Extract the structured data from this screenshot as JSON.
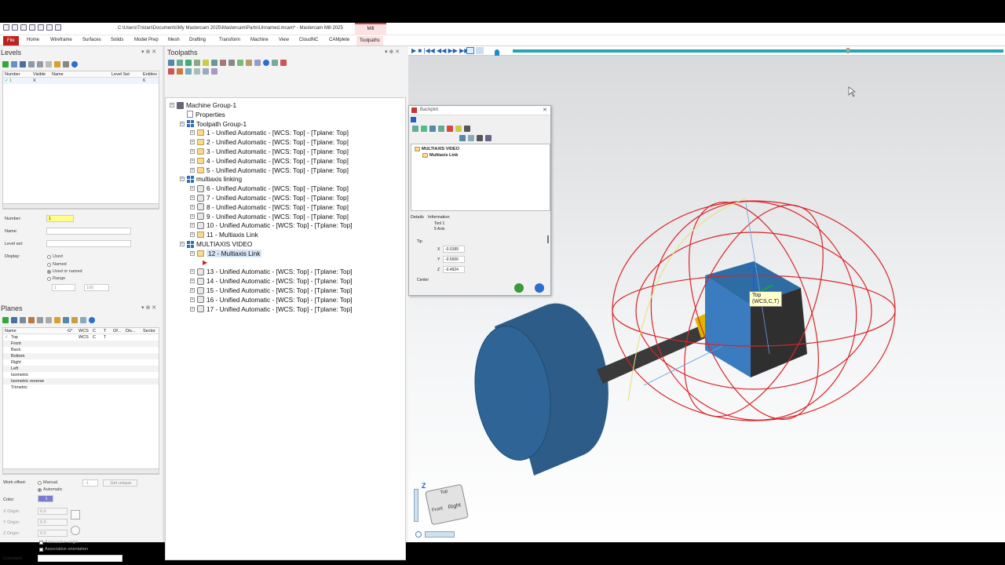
{
  "title_bar": {
    "window_title": "C:\\Users\\Tristan\\Documents\\My Mastercam 2025\\Mastercam\\Parts\\Unnamed.mcam* - Mastercam Mill 2025",
    "context_tab": "Mill"
  },
  "ribbon": {
    "tabs": [
      "File",
      "Home",
      "Wireframe",
      "Surfaces",
      "Solids",
      "Model Prep",
      "Mesh",
      "Drafting",
      "Transform",
      "Machine",
      "View",
      "CloudNC",
      "CAMplete",
      "Toolpaths"
    ]
  },
  "levels": {
    "title": "Levels",
    "columns": [
      "Number",
      "Visible",
      "Name",
      "Level Set",
      "Entities"
    ],
    "rows": [
      {
        "check": "✓",
        "number": "1",
        "visible": "X",
        "name": "",
        "level_set": "",
        "entities": "6"
      }
    ],
    "number_label": "Number:",
    "number_value": "1",
    "name_label": "Name:",
    "level_set_label": "Level set:",
    "display_label": "Display:",
    "display_options": [
      "Used",
      "Named",
      "Used or named",
      "Range"
    ],
    "display_selected": "Used or named",
    "range_from": "1",
    "range_to": "100"
  },
  "planes": {
    "title": "Planes",
    "columns": [
      "Name",
      "G*",
      "WCS",
      "C",
      "T",
      "Of...",
      "Dis...",
      "Sector"
    ],
    "rows": [
      {
        "check": "✓",
        "name": "Top",
        "wcs": "WCS",
        "c": "C",
        "t": "T"
      },
      {
        "check": "",
        "name": "Front",
        "wcs": "",
        "c": "",
        "t": ""
      },
      {
        "check": "",
        "name": "Back",
        "wcs": "",
        "c": "",
        "t": ""
      },
      {
        "check": "",
        "name": "Bottom",
        "wcs": "",
        "c": "",
        "t": ""
      },
      {
        "check": "",
        "name": "Right",
        "wcs": "",
        "c": "",
        "t": ""
      },
      {
        "check": "",
        "name": "Left",
        "wcs": "",
        "c": "",
        "t": ""
      },
      {
        "check": "",
        "name": "Isometric",
        "wcs": "",
        "c": "",
        "t": ""
      },
      {
        "check": "",
        "name": "Isometric reverse",
        "wcs": "",
        "c": "",
        "t": ""
      },
      {
        "check": "",
        "name": "Trimetric",
        "wcs": "",
        "c": "",
        "t": ""
      }
    ],
    "work_offset_label": "Work offset:",
    "manual_label": "Manual",
    "automatic_label": "Automatic",
    "offset_value": "-1",
    "get_unique_label": "Get unique",
    "color_label": "Color:",
    "color_value": "1",
    "x_origin_label": "X Origin:",
    "y_origin_label": "Y Origin:",
    "z_origin_label": "Z Origin:",
    "x_origin": "0.0",
    "y_origin": "0.0",
    "z_origin": "0.0",
    "assoc_origin": "Associative origin",
    "assoc_orientation": "Associative orientation",
    "comment_label": "Comment:"
  },
  "toolpaths": {
    "title": "Toolpaths",
    "machine_group": "Machine Group-1",
    "properties": "Properties",
    "group1": "Toolpath Group-1",
    "group1_ops": [
      "1 - Unified Automatic - [WCS: Top] - [Tplane: Top]",
      "2 - Unified Automatic - [WCS: Top] - [Tplane: Top]",
      "3 - Unified Automatic - [WCS: Top] - [Tplane: Top]",
      "4 - Unified Automatic - [WCS: Top] - [Tplane: Top]",
      "5 - Unified Automatic - [WCS: Top] - [Tplane: Top]"
    ],
    "group2": "multiaxis linking",
    "group2_ops": [
      "6 - Unified Automatic - [WCS: Top] - [Tplane: Top]",
      "7 - Unified Automatic - [WCS: Top] - [Tplane: Top]",
      "8 - Unified Automatic - [WCS: Top] - [Tplane: Top]",
      "9 - Unified Automatic - [WCS: Top] - [Tplane: Top]",
      "10 - Unified Automatic - [WCS: Top] - [Tplane: Top]",
      "11 - Multiaxis Link"
    ],
    "group3": "MULTIAXIS VIDEO",
    "selected_op": "12 - Multiaxis Link",
    "group3_ops": [
      "13 - Unified Automatic - [WCS: Top] - [Tplane: Top]",
      "14 - Unified Automatic - [WCS: Top] - [Tplane: Top]",
      "15 - Unified Automatic - [WCS: Top] - [Tplane: Top]",
      "16 - Unified Automatic - [WCS: Top] - [Tplane: Top]",
      "17 - Unified Automatic - [WCS: Top] - [Tplane: Top]"
    ]
  },
  "backplot": {
    "title": "Backplot",
    "tree_root": "MULTIAXIS VIDEO",
    "tree_child": "Multiaxis Link",
    "details_label": "Details",
    "information_label": "Information",
    "tool": "Tool 1",
    "axis": "5 Axis",
    "tip_label": "Tip",
    "x_label": "X",
    "y_label": "Y",
    "z_label": "Z",
    "x": "-0.0189",
    "y": "-0.5000",
    "z": "-0.4924",
    "center_label": "Center"
  },
  "viewport": {
    "tooltip_line1": "Top",
    "tooltip_line2": "(WCS,C,T)",
    "gnomon_z": "Z",
    "cube_top": "Top",
    "cube_front": "Front",
    "cube_right": "Right"
  },
  "colors": {
    "accent": "#c8242b",
    "stock": "#2a5d8a",
    "sphere": "#d9252a",
    "tool": "#e0b400",
    "progress": "#27a5b5"
  }
}
